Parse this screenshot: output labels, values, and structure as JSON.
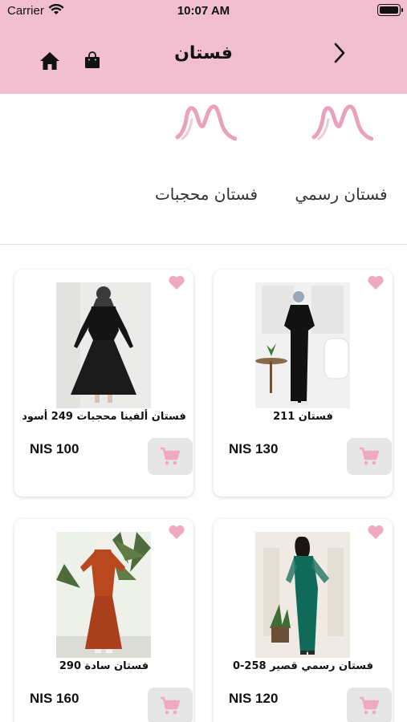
{
  "status_bar": {
    "carrier": "Carrier",
    "time": "10:07 AM"
  },
  "header": {
    "title": "فستان",
    "icons": [
      "home-icon",
      "shopping-bag-icon",
      "chevron-right-icon"
    ]
  },
  "categories": [
    {
      "label": "فستان محجبات"
    },
    {
      "label": "فستان رسمي"
    }
  ],
  "products": [
    {
      "name": "فستان ألفينا محجبات 249 أسود",
      "price": "NIS 100"
    },
    {
      "name": "فستان 211",
      "price": "NIS 130"
    },
    {
      "name": "فستان سادة 290",
      "price": "NIS 160"
    },
    {
      "name": "فستان رسمي قصير 258-0",
      "price": "NIS 120"
    }
  ],
  "colors": {
    "header_bg": "#f2bfd1",
    "heart": "#f0a9c3",
    "cart_icon": "#f0a9c3",
    "cart_bg": "#e6e6e6"
  }
}
